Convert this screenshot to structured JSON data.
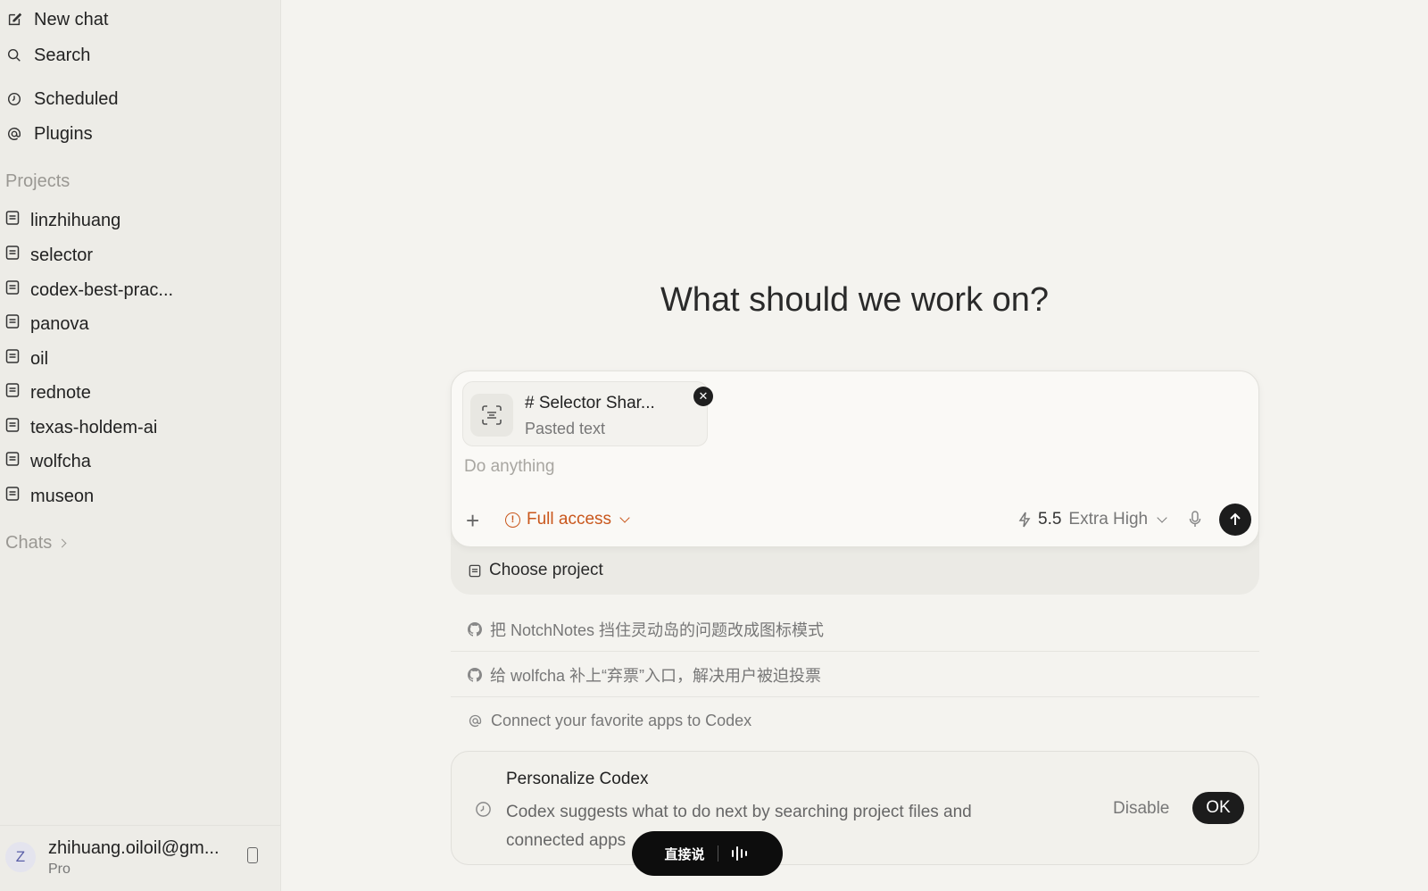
{
  "sidebar": {
    "nav": [
      {
        "label": "New chat",
        "icon": "edit-icon"
      },
      {
        "label": "Search",
        "icon": "search-icon"
      },
      {
        "label": "Scheduled",
        "icon": "clock-icon"
      },
      {
        "label": "Plugins",
        "icon": "at-icon"
      }
    ],
    "projects_label": "Projects",
    "projects": [
      "linzhihuang",
      "selector",
      "codex-best-prac...",
      "panova",
      "oil",
      "rednote",
      "texas-holdem-ai",
      "wolfcha",
      "museon"
    ],
    "chats_label": "Chats",
    "account": {
      "avatar_letter": "Z",
      "email": "zhihuang.oiloil@gm...",
      "plan": "Pro"
    }
  },
  "main": {
    "headline": "What should we work on?",
    "composer": {
      "attachment_title": "# Selector Shar...",
      "attachment_subtitle": "Pasted text",
      "placeholder": "Do anything",
      "access_label": "Full access",
      "model_version": "5.5",
      "model_effort": "Extra High"
    },
    "choose_project": "Choose project",
    "suggestions": [
      {
        "text": "把 NotchNotes 挡住灵动岛的问题改成图标模式",
        "icon": "github-icon"
      },
      {
        "text": "给 wolfcha 补上“弃票”入口，解决用户被迫投票",
        "icon": "github-icon"
      },
      {
        "text": "Connect your favorite apps to Codex",
        "icon": "at-icon"
      }
    ],
    "personalize": {
      "title": "Personalize Codex",
      "description": "Codex suggests what to do next by searching project files and connected apps",
      "disable_label": "Disable",
      "ok_label": "OK"
    },
    "voice_pill": {
      "label": "直接说"
    }
  },
  "colors": {
    "accent_warning": "#c9571c",
    "background": "#f4f3ef",
    "sidebar": "#edece7"
  }
}
